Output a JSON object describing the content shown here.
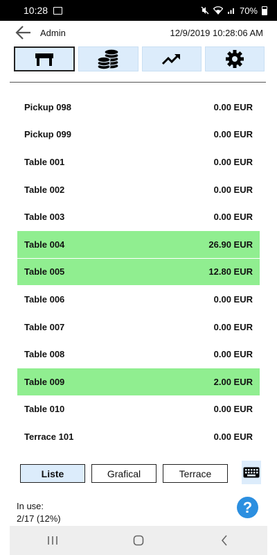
{
  "status_bar": {
    "time": "10:28",
    "battery": "70%"
  },
  "header": {
    "user": "Admin",
    "datetime": "12/9/2019 10:28:06 AM"
  },
  "toolbar": {
    "buttons": [
      {
        "icon": "table-icon",
        "active": true
      },
      {
        "icon": "coins-icon",
        "active": false
      },
      {
        "icon": "trend-up-icon",
        "active": false
      },
      {
        "icon": "gear-icon",
        "active": false
      }
    ]
  },
  "tables": [
    {
      "name": "Pickup 098",
      "amount": "0.00 EUR",
      "busy": false
    },
    {
      "name": "Pickup 099",
      "amount": "0.00 EUR",
      "busy": false
    },
    {
      "name": "Table 001",
      "amount": "0.00 EUR",
      "busy": false
    },
    {
      "name": "Table 002",
      "amount": "0.00 EUR",
      "busy": false
    },
    {
      "name": "Table 003",
      "amount": "0.00 EUR",
      "busy": false
    },
    {
      "name": "Table 004",
      "amount": "26.90 EUR",
      "busy": true
    },
    {
      "name": "Table 005",
      "amount": "12.80 EUR",
      "busy": true
    },
    {
      "name": "Table 006",
      "amount": "0.00 EUR",
      "busy": false
    },
    {
      "name": "Table 007",
      "amount": "0.00 EUR",
      "busy": false
    },
    {
      "name": "Table 008",
      "amount": "0.00 EUR",
      "busy": false
    },
    {
      "name": "Table 009",
      "amount": "2.00 EUR",
      "busy": true
    },
    {
      "name": "Table 010",
      "amount": "0.00 EUR",
      "busy": false
    },
    {
      "name": "Terrace 101",
      "amount": "0.00 EUR",
      "busy": false
    }
  ],
  "view_tabs": [
    {
      "label": "Liste",
      "active": true
    },
    {
      "label": "Grafical",
      "active": false
    },
    {
      "label": "Terrace",
      "active": false
    }
  ],
  "footer": {
    "in_use_label": "In use:",
    "in_use_value": "2/17 (12%)",
    "help": "?"
  },
  "colors": {
    "busy": "#90ee90",
    "button_bg": "#dcecfb",
    "help_bg": "#2c8fe0"
  }
}
